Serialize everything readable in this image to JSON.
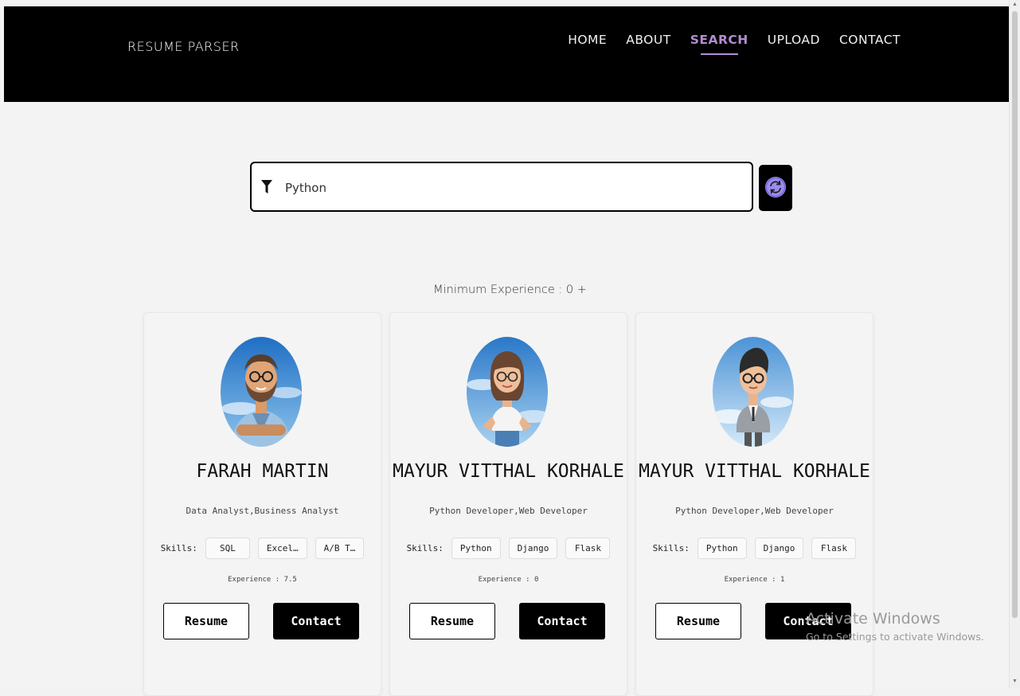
{
  "brand": "RESUME PARSER",
  "nav": [
    {
      "label": "HOME",
      "active": false
    },
    {
      "label": "ABOUT",
      "active": false
    },
    {
      "label": "SEARCH",
      "active": true
    },
    {
      "label": "UPLOAD",
      "active": false
    },
    {
      "label": "CONTACT",
      "active": false
    }
  ],
  "search": {
    "value": "Python",
    "icon": "filter-icon",
    "refresh_icon": "refresh-icon"
  },
  "min_experience": "Minimum Experience : 0 +",
  "skills_label": "Skills:",
  "cards": [
    {
      "name": "FARAH MARTIN",
      "role": "Data Analyst,Business Analyst",
      "skills": [
        "SQL",
        "Excel…",
        "A/B T…"
      ],
      "experience": "Experience : 7.5",
      "resume_label": "Resume",
      "contact_label": "Contact",
      "avatar": "avatar-man-beard"
    },
    {
      "name": "MAYUR VITTHAL KORHALE",
      "role": "Python Developer,Web Developer",
      "skills": [
        "Python",
        "Django",
        "Flask"
      ],
      "experience": "Experience : 0",
      "resume_label": "Resume",
      "contact_label": "Contact",
      "avatar": "avatar-woman"
    },
    {
      "name": "MAYUR VITTHAL KORHALE",
      "role": "Python Developer,Web Developer",
      "skills": [
        "Python",
        "Django",
        "Flask"
      ],
      "experience": "Experience : 1",
      "resume_label": "Resume",
      "contact_label": "Contact",
      "avatar": "avatar-man-suit"
    }
  ],
  "watermark": {
    "title": "Activate Windows",
    "subtitle": "Go to Settings to activate Windows."
  },
  "colors": {
    "accent": "#b28dd2",
    "navbar": "#000000",
    "refresh": "#9a8cf0"
  }
}
